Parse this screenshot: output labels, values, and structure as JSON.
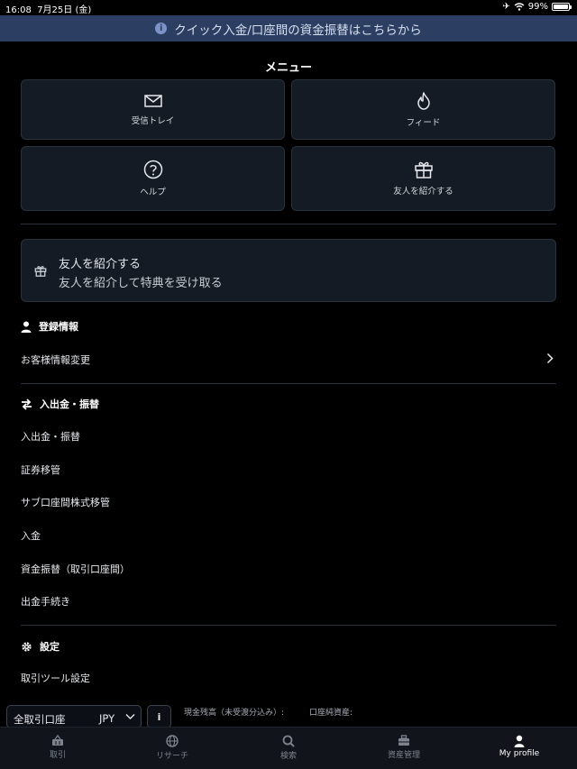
{
  "status_bar": {
    "time": "16:08",
    "date": "7月25日 (金)",
    "battery": "99%"
  },
  "banner": {
    "text": "クイック入金/口座間の資金振替はこちらから"
  },
  "page": {
    "title": "メニュー"
  },
  "tiles": [
    {
      "label": "受信トレイ",
      "icon": "mail-icon"
    },
    {
      "label": "フィード",
      "icon": "flame-icon"
    },
    {
      "label": "ヘルプ",
      "icon": "help-icon"
    },
    {
      "label": "友人を紹介する",
      "icon": "gift-icon"
    }
  ],
  "promo": {
    "title": "友人を紹介する",
    "subtitle": "友人を紹介して特典を受け取る"
  },
  "sections": {
    "registration": {
      "title": "登録情報",
      "items": [
        "お客様情報変更"
      ]
    },
    "transfers": {
      "title": "入出金・振替",
      "items": [
        "入出金・振替",
        "証券移管",
        "サブ口座間株式移管",
        "入金",
        "資金振替（取引口座間）",
        "出金手続き"
      ]
    },
    "settings": {
      "title": "設定",
      "items": [
        "取引ツール設定"
      ]
    }
  },
  "account_bar": {
    "account": "全取引口座",
    "currency": "JPY",
    "info_label": "i",
    "cash_label": "現金残高（未受渡分込み）:",
    "net_assets_label": "口座純資産:"
  },
  "tabbar": {
    "items": [
      {
        "label": "取引",
        "icon": "basket-icon"
      },
      {
        "label": "リサーチ",
        "icon": "globe-icon"
      },
      {
        "label": "検索",
        "icon": "search-icon"
      },
      {
        "label": "資産管理",
        "icon": "briefcase-icon"
      },
      {
        "label": "My profile",
        "icon": "person-icon",
        "active": true
      }
    ]
  }
}
